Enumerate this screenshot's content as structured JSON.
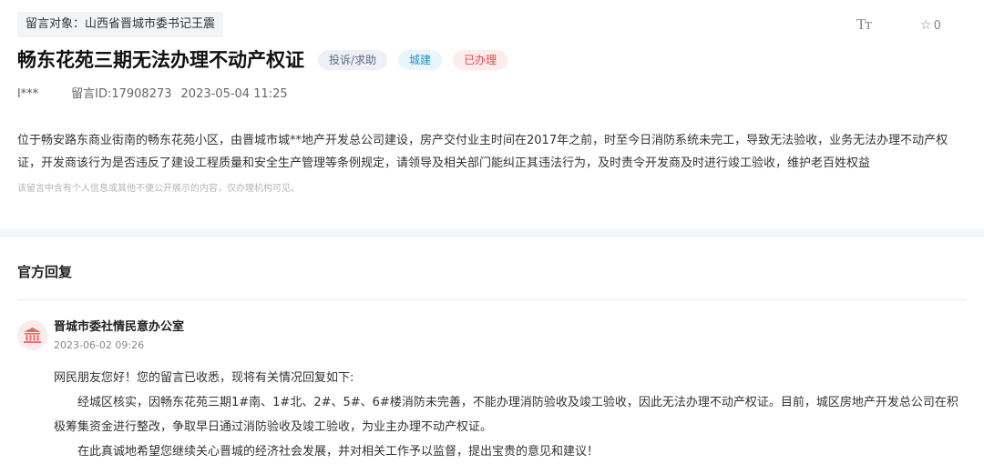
{
  "message": {
    "recipient": "留言对象：山西省晋城市委书记王震",
    "font_toggle": "Tт",
    "favorite_count": "0",
    "title": "畅东花苑三期无法办理不动产权证",
    "tags": {
      "type": "投诉/求助",
      "dept": "城建",
      "status": "已办理"
    },
    "user": "l***",
    "id": "留言ID:17908273",
    "time": "2023-05-04 11:25",
    "content": "位于畅安路东商业街南的畅东花苑小区，由晋城市城**地产开发总公司建设，房产交付业主时间在2017年之前，时至今日消防系统未完工，导致无法验收，业务无法办理不动产权证，开发商该行为是否违反了建设工程质量和安全生产管理等条例规定，请领导及相关部门能纠正其违法行为，及时责令开发商及时进行竣工验收，维护老百姓权益",
    "privacy_notice": "该留言中含有个人信息或其他不便公开展示的内容，仅办理机构可见。"
  },
  "reply": {
    "heading": "官方回复",
    "org_name": "晋城市委社情民意办公室",
    "date": "2023-06-02 09:26",
    "greeting": "网民朋友您好！您的留言已收悉，现将有关情况回复如下:",
    "para1": "经城区核实，因畅东花苑三期1#南、1#北、2#、5#、6#楼消防未完善，不能办理消防验收及竣工验收，因此无法办理不动产权证。目前，城区房地产开发总公司在积极筹集资金进行整改，争取早日通过消防验收及竣工验收，为业主办理不动产权证。",
    "para2": "在此真诚地希望您继续关心晋城的经济社会发展，并对相关工作予以监督，提出宝贵的意见和建议！"
  },
  "icons": {
    "font_size": "font-size-icon",
    "favorite": "star-outline-icon",
    "org": "government-building-icon"
  },
  "colors": {
    "status_red": "#e04a4a",
    "dept_blue": "#2a8fc4",
    "icon_red": "#e66a6a"
  }
}
